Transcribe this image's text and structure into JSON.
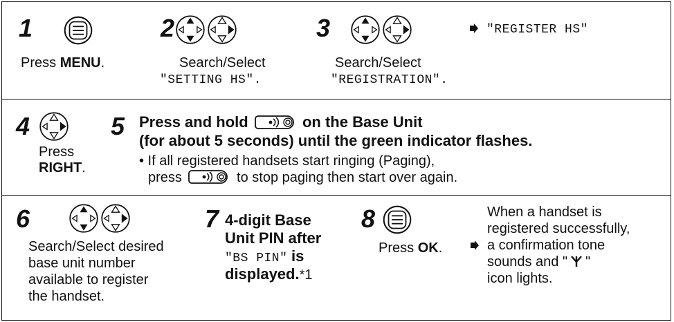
{
  "step1": {
    "number": "1",
    "label_pre": "Press ",
    "label_bold": "MENU",
    "label_post": "."
  },
  "step2": {
    "number": "2",
    "label": "Search/Select",
    "value": "\"SETTING HS\"."
  },
  "step3": {
    "number": "3",
    "label": "Search/Select",
    "value": "\"REGISTRATION\"."
  },
  "step3_result": {
    "value": "\"REGISTER HS\""
  },
  "step4": {
    "number": "4",
    "line1": "Press",
    "line2_bold": "RIGHT",
    "line2_post": "."
  },
  "step5": {
    "number": "5",
    "line1_pre": "Press and hold",
    "line1_post": "on the Base Unit",
    "line2": "(for about 5 seconds) until the green indicator flashes.",
    "note_line1": "• If all registered handsets start ringing (Paging),",
    "note_line2_pre": "press",
    "note_line2_post": "to stop paging then start over again."
  },
  "step6": {
    "number": "6",
    "lines": [
      "Search/Select desired",
      "base unit number",
      "available to register",
      "the handset."
    ]
  },
  "step7": {
    "number": "7",
    "line1": "4-digit Base",
    "line2": "Unit PIN after",
    "line3_mono": "\"BS PIN\"",
    "line3_bold": "is",
    "line4_bold": "displayed.",
    "line4_post": "*1"
  },
  "step8": {
    "number": "8",
    "label_pre": "Press ",
    "label_bold": "OK",
    "label_post": "."
  },
  "step8_result": {
    "line1": "When a handset is",
    "line2": "registered successfully,",
    "line3": "a confirmation tone",
    "line4_pre": "sounds and \"",
    "line4_post": "\"",
    "line5": "icon lights."
  },
  "icons": {
    "menu": "menu-button-icon",
    "navigator_up_down": "navigator-up-down-icon",
    "navigator_right": "navigator-right-icon",
    "paging": "paging-button-icon",
    "arrow": "arrow-right-icon",
    "antenna": "antenna-icon"
  }
}
